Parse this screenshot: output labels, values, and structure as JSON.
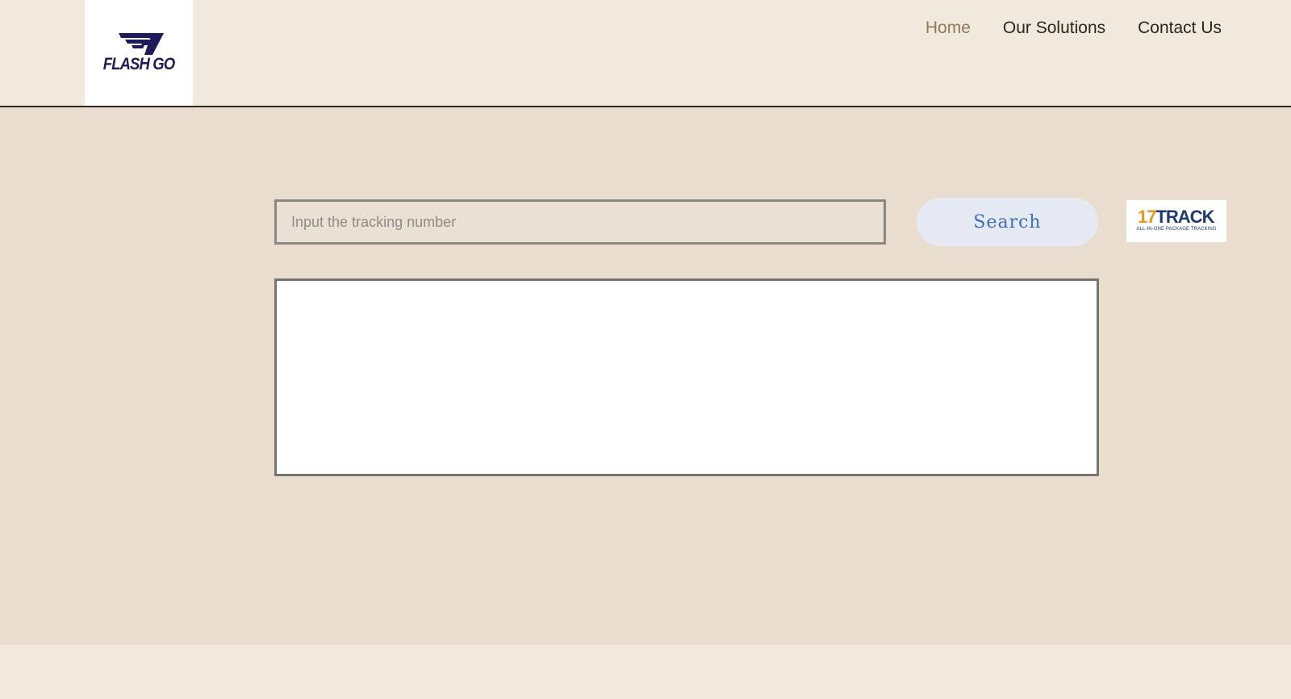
{
  "brand": {
    "logo_text": "FLASH GO",
    "logo_icon": "winged-f-logo-icon",
    "logo_color": "#1f1a5a"
  },
  "nav": {
    "items": [
      {
        "label": "Home",
        "active": true
      },
      {
        "label": "Our Solutions",
        "active": false
      },
      {
        "label": "Contact Us",
        "active": false
      }
    ],
    "active_color": "#8d7a5a",
    "text_color": "#2b2520"
  },
  "tracking": {
    "placeholder": "Input the tracking number",
    "value": "",
    "search_label": "Search",
    "search_color": "#3b6fb6"
  },
  "partner_badge": {
    "number": "17",
    "name": "TRACK",
    "tagline": "ALL-IN-ONE PACKAGE TRACKING",
    "accent": "#e6951f",
    "brand_color": "#1e3a6e"
  },
  "colors": {
    "header_bg": "#f1e9dc",
    "main_bg": "#e8ddcf",
    "panel_bg": "#ffffff"
  }
}
